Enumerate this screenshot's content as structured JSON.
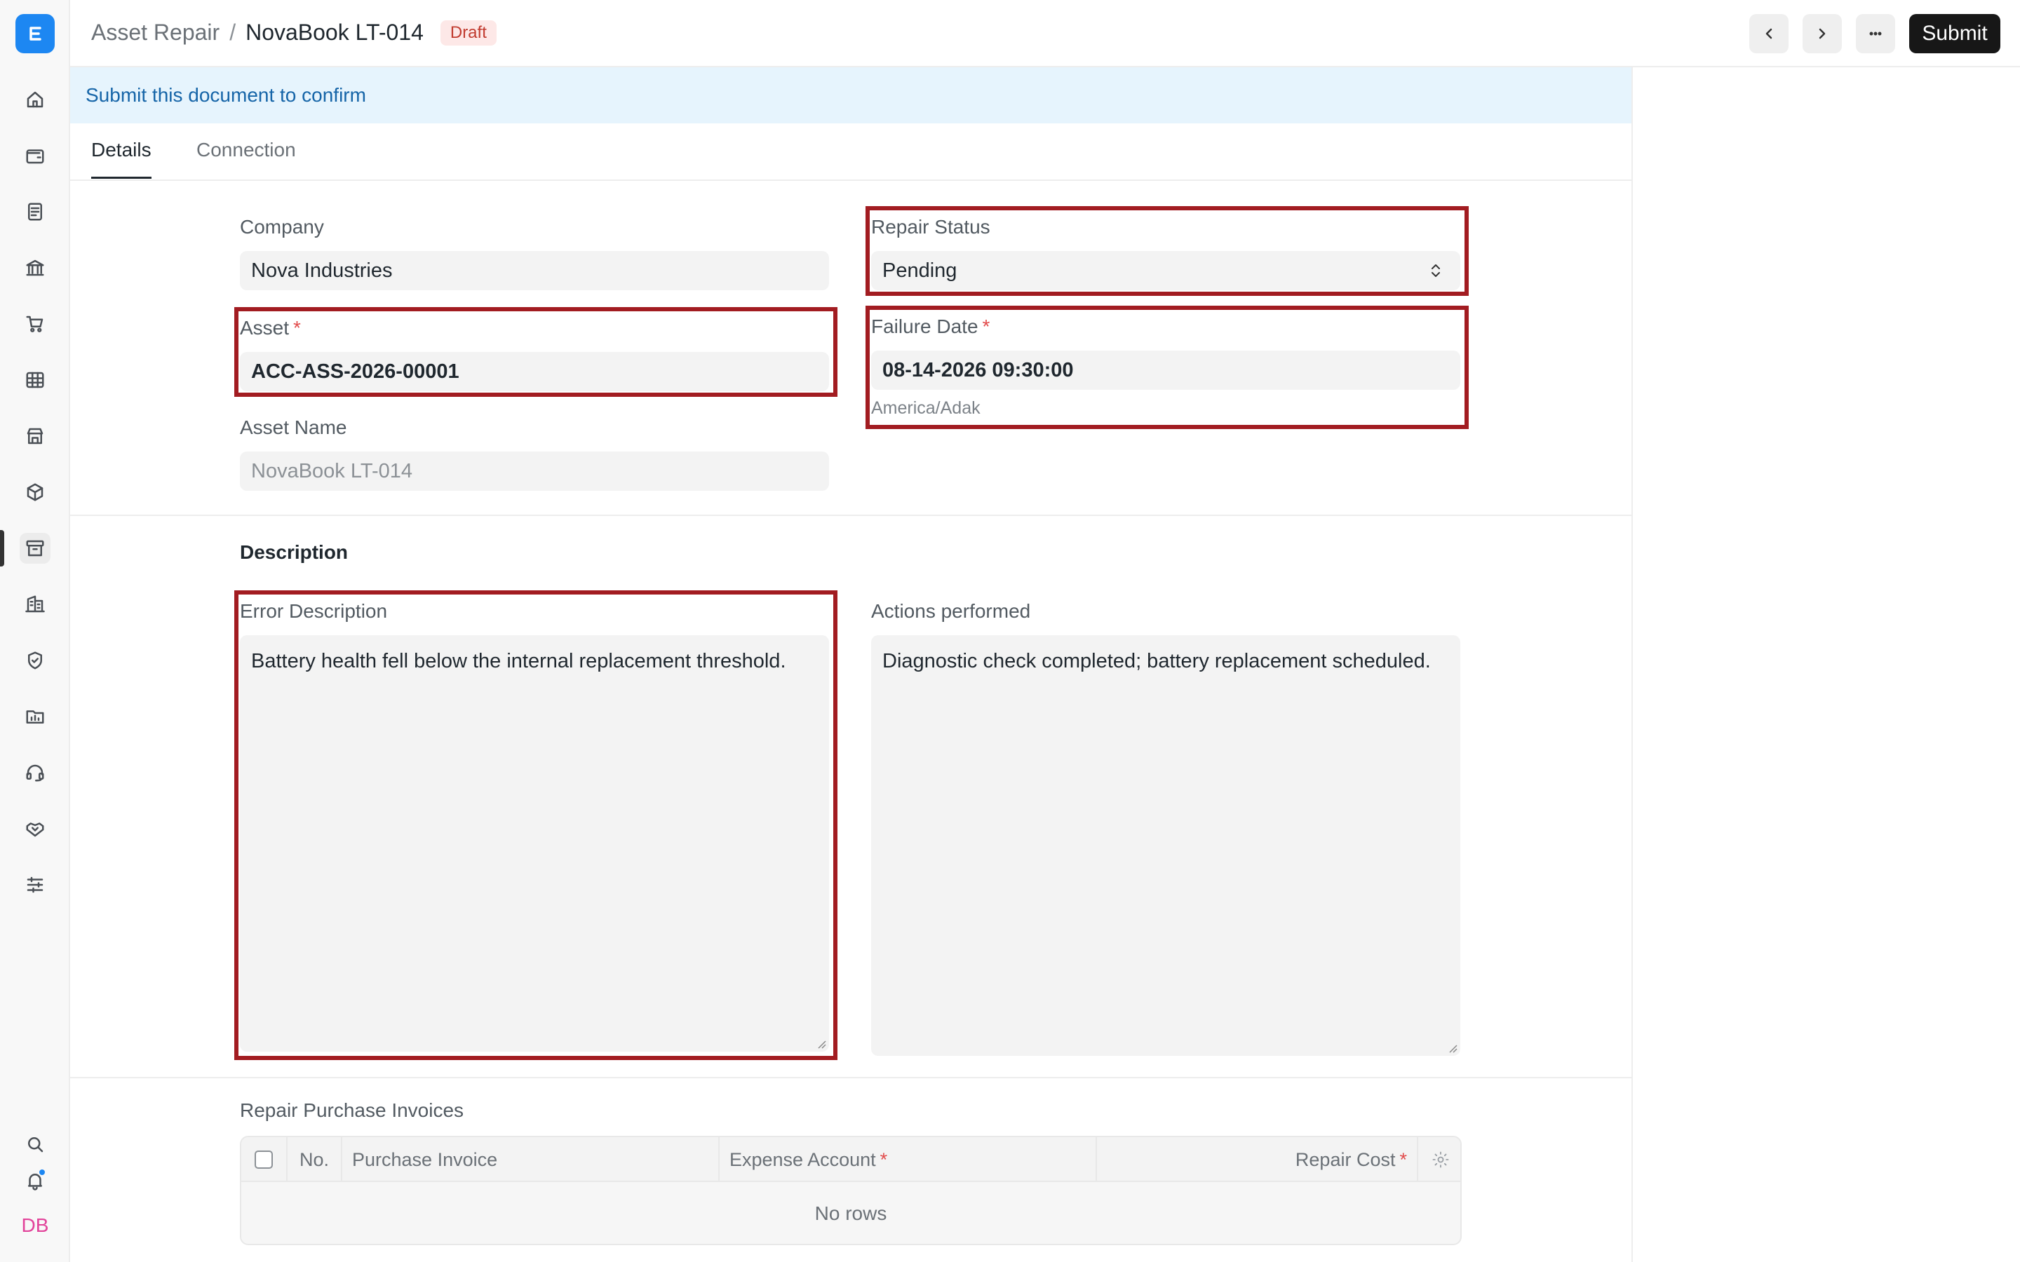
{
  "header": {
    "breadcrumb_parent": "Asset Repair",
    "breadcrumb_separator": "/",
    "title": "NovaBook LT-014",
    "status_badge": "Draft",
    "submit_label": "Submit"
  },
  "sidebar": {
    "items": [
      {
        "icon": "home-icon"
      },
      {
        "icon": "wallet-icon"
      },
      {
        "icon": "document-icon"
      },
      {
        "icon": "bank-icon"
      },
      {
        "icon": "cart-icon"
      },
      {
        "icon": "table-icon"
      },
      {
        "icon": "store-icon"
      },
      {
        "icon": "package-icon"
      },
      {
        "icon": "archive-icon"
      },
      {
        "icon": "building-icon"
      },
      {
        "icon": "shield-icon"
      },
      {
        "icon": "folder-chart-icon"
      },
      {
        "icon": "headset-icon"
      },
      {
        "icon": "handshake-icon"
      },
      {
        "icon": "sliders-icon"
      }
    ],
    "avatar_initials": "DB"
  },
  "alert": {
    "text": "Submit this document to confirm"
  },
  "tabs": [
    {
      "label": "Details",
      "active": true
    },
    {
      "label": "Connection",
      "active": false
    }
  ],
  "form": {
    "company": {
      "label": "Company",
      "value": "Nova Industries"
    },
    "repair_status": {
      "label": "Repair Status",
      "value": "Pending"
    },
    "asset": {
      "label": "Asset",
      "required_mark": "*",
      "value": "ACC-ASS-2026-00001"
    },
    "failure_date": {
      "label": "Failure Date",
      "required_mark": "*",
      "value": "08-14-2026 09:30:00",
      "timezone": "America/Adak"
    },
    "asset_name": {
      "label": "Asset Name",
      "value": "NovaBook LT-014"
    },
    "description_section": "Description",
    "error_description": {
      "label": "Error Description",
      "value": "Battery health fell below the internal replacement threshold."
    },
    "actions_performed": {
      "label": "Actions performed",
      "value": "Diagnostic check completed; battery replacement scheduled."
    }
  },
  "purchase_invoices": {
    "title": "Repair Purchase Invoices",
    "columns": {
      "no": "No.",
      "purchase_invoice": "Purchase Invoice",
      "expense_account": "Expense Account",
      "repair_cost": "Repair Cost",
      "required_mark": "*"
    },
    "empty_text": "No rows"
  },
  "colors": {
    "accent": "#1d87f2",
    "highlight_border": "#a21c21",
    "alert_bg": "#e6f4fd",
    "badge_text": "#c13b2f"
  }
}
